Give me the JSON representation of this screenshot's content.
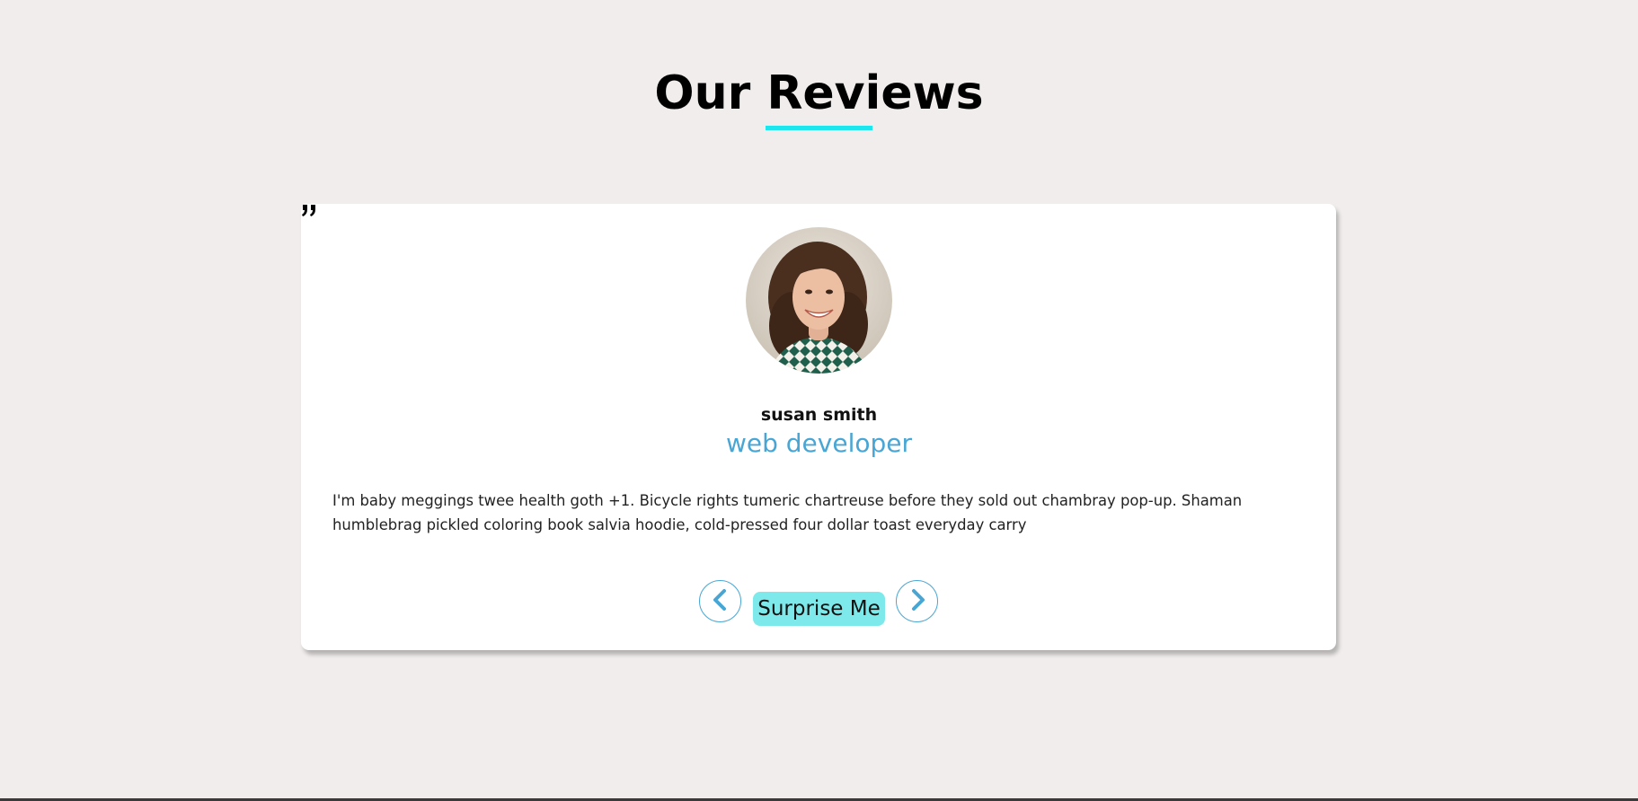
{
  "header": {
    "title": "Our Reviews",
    "underline_color": "#1ee6ef"
  },
  "review": {
    "quote_icon": "quote-right-icon",
    "avatar_alt": "susan smith",
    "name": "susan smith",
    "job": "web developer",
    "text": "I'm baby meggings twee health goth +1. Bicycle rights tumeric chartreuse before they sold out chambray pop-up. Shaman humblebrag pickled coloring book salvia hoodie, cold-pressed four dollar toast everyday carry"
  },
  "controls": {
    "prev_icon": "chevron-left-icon",
    "next_icon": "chevron-right-icon",
    "surprise_label": "Surprise Me"
  },
  "colors": {
    "background": "#f1eded",
    "accent": "#49a6d4",
    "surprise_button": "#7ee9ea",
    "card": "#ffffff"
  }
}
